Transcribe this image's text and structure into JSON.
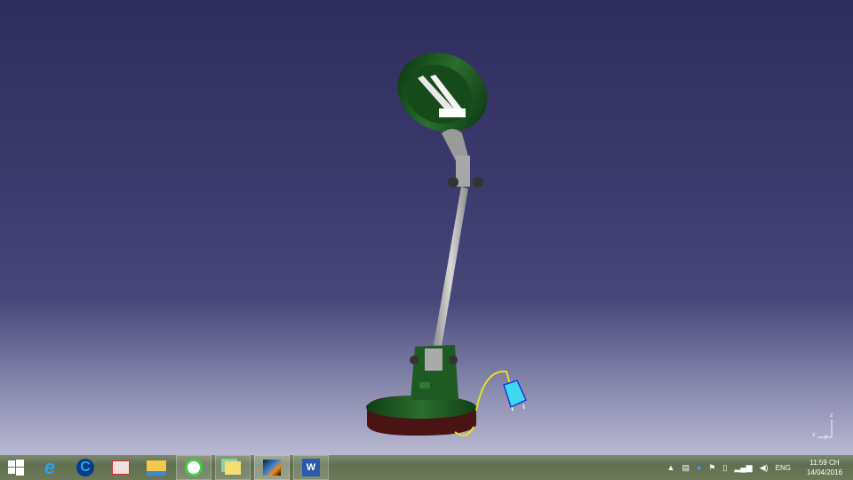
{
  "viewer": {
    "axis": {
      "x": "x",
      "y": "y",
      "z": "z"
    }
  },
  "colors": {
    "lamp_green": "#1f5a24",
    "arm_gray": "#b5b5b5",
    "base_bottom": "#4a1212",
    "cord": "#e8e020",
    "plug": "#40d8f0"
  },
  "taskbar": {
    "items": [
      {
        "name": "start",
        "icon": "windows-logo-icon"
      },
      {
        "name": "internet-explorer",
        "icon": "ie-icon"
      },
      {
        "name": "app-c",
        "icon": "c-app-icon"
      },
      {
        "name": "unikey",
        "icon": "unikey-icon"
      },
      {
        "name": "file-explorer",
        "icon": "folder-icon"
      },
      {
        "name": "coc-coc",
        "icon": "coccoc-icon"
      },
      {
        "name": "sticky-notes",
        "icon": "notes-icon"
      },
      {
        "name": "catia",
        "icon": "catia-icon"
      },
      {
        "name": "word",
        "icon": "word-icon",
        "label": "W"
      }
    ]
  },
  "tray": {
    "language": "ENG",
    "time": "11:59 CH",
    "date": "14/04/2016"
  }
}
